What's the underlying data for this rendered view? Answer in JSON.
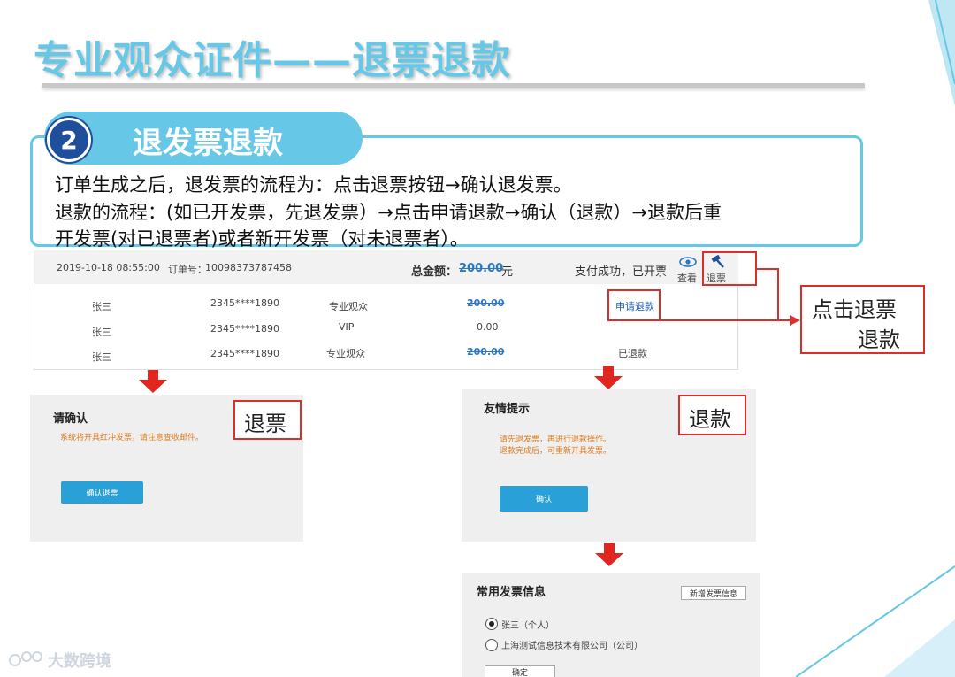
{
  "slide": {
    "title": "专业观众证件——退票退款"
  },
  "section": {
    "number": "2",
    "heading": "退发票退款",
    "lines": [
      "订单生成之后，退发票的流程为：点击退票按钮→确认退发票。",
      "退款的流程：(如已开发票，先退发票）→点击申请退款→确认（退款）→退款后重",
      "开发票(对已退票者)或者新开发票（对未退票者）。"
    ]
  },
  "order": {
    "datetime": "2019-10-18 08:55:00",
    "order_no_label": "订单号：",
    "order_no": "10098373787458",
    "total_label": "总金额：",
    "total_value": "200.00",
    "total_unit": "元",
    "status": "支付成功，已开票",
    "view_label": "查看",
    "refund_ticket_label": "退票",
    "rows": [
      {
        "name": "张三",
        "phone": "2345****1890",
        "type": "专业观众",
        "price": "200.00",
        "action": "申请退款"
      },
      {
        "name": "张三",
        "phone": "2345****1890",
        "type": "VIP",
        "price": "0.00",
        "action": ""
      },
      {
        "name": "张三",
        "phone": "2345****1890",
        "type": "专业观众",
        "price": "200.00",
        "action": "已退款"
      }
    ]
  },
  "callouts": {
    "click_refund_line1": "点击退票",
    "click_refund_line2": "退款",
    "ticket_refund": "退票",
    "money_refund": "退款"
  },
  "dialog_confirm": {
    "title": "请确认",
    "note": "系统将开具红冲发票，请注意查收邮件。",
    "button": "确认退票"
  },
  "dialog_tip": {
    "title": "友情提示",
    "note_line1": "请先退发票，再进行退款操作。",
    "note_line2": "退款完成后，可重新开具发票。",
    "button": "确认"
  },
  "invoice": {
    "title": "常用发票信息",
    "new_button": "新增发票信息",
    "options": [
      {
        "label": "张三（个人）",
        "checked": true
      },
      {
        "label": "上海测试信息技术有限公司（公司）",
        "checked": false
      }
    ],
    "confirm_button": "确定"
  },
  "watermark": "大数跨境",
  "colors": {
    "title_blue": "#67c7e6",
    "number_navy": "#1f4f9a",
    "callout_red": "#d9302c",
    "button_blue": "#29a0d8",
    "note_orange": "#e07b20"
  }
}
